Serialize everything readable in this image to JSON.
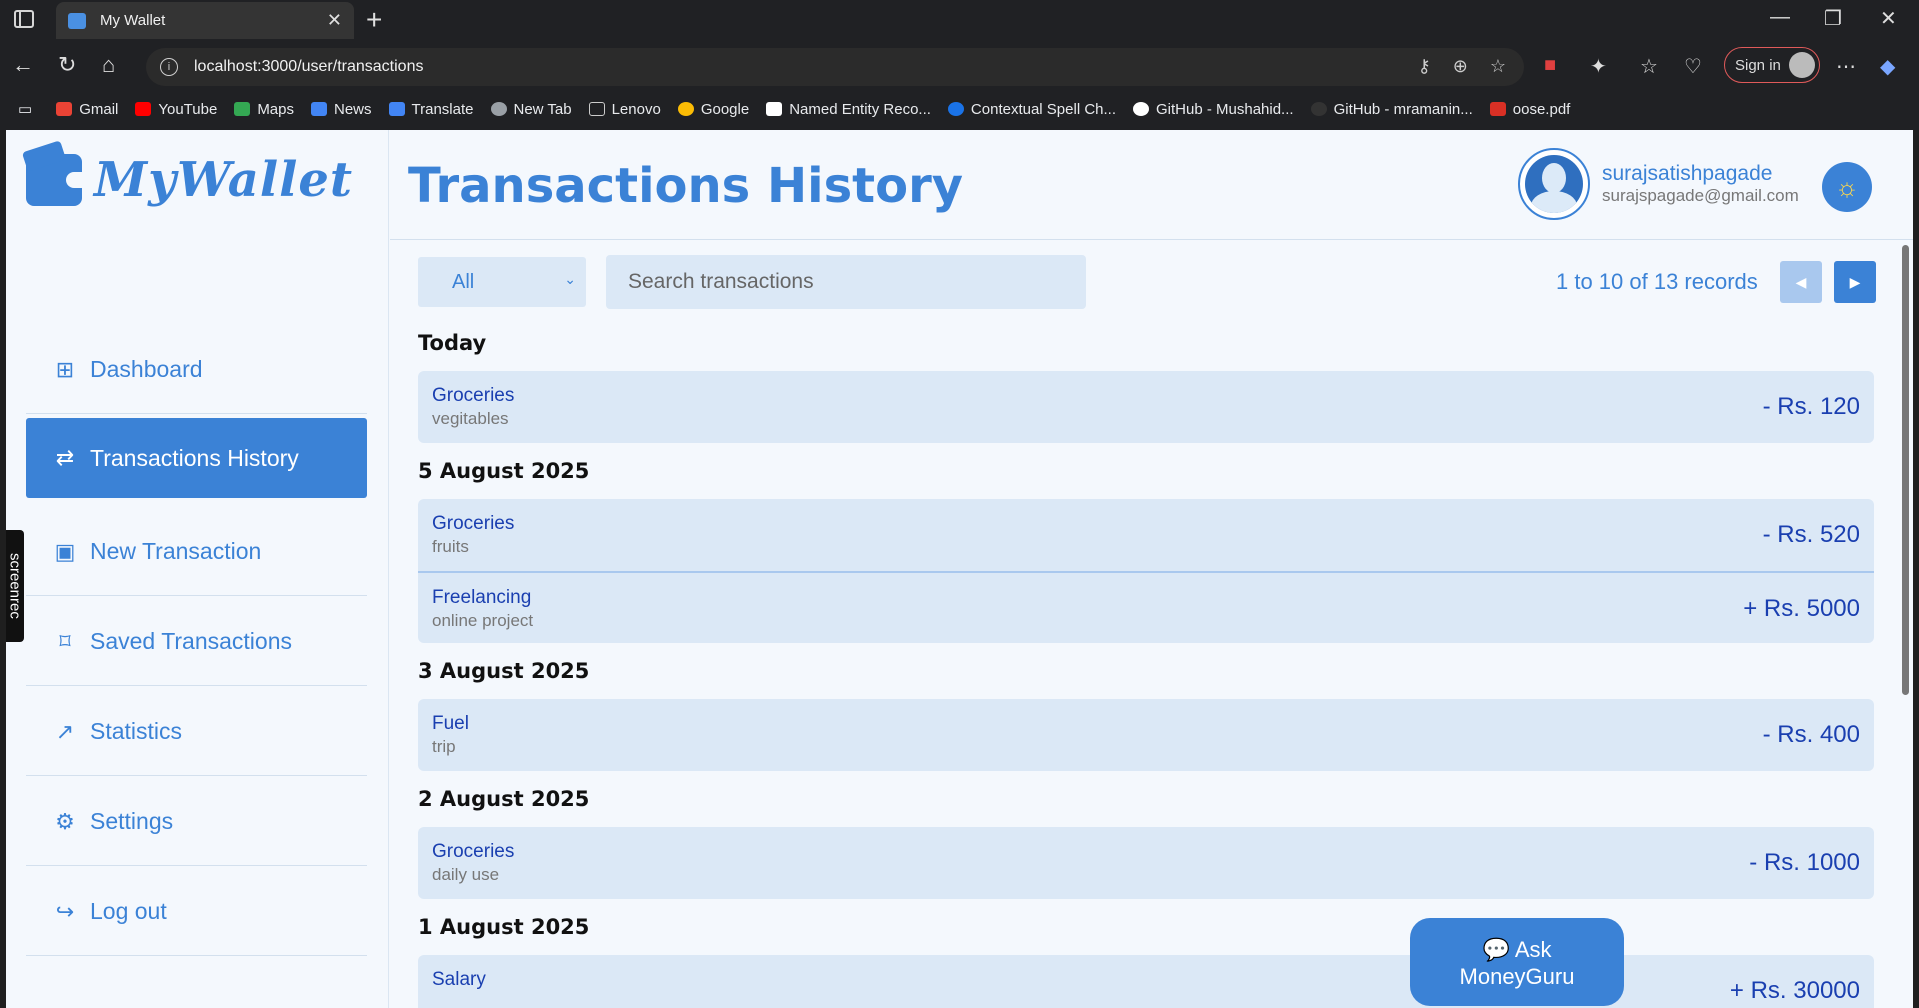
{
  "browser": {
    "tab_title": "My Wallet",
    "new_tab": "+",
    "url": "localhost:3000/user/transactions",
    "sign_in": "Sign in",
    "bookmarks": [
      {
        "label": "Gmail",
        "color": "#ea4335"
      },
      {
        "label": "YouTube",
        "color": "#ff0000"
      },
      {
        "label": "Maps",
        "color": "#34a853"
      },
      {
        "label": "News",
        "color": "#4285f4"
      },
      {
        "label": "Translate",
        "color": "#4285f4"
      },
      {
        "label": "New Tab",
        "color": "#9aa0a6"
      },
      {
        "label": "Lenovo",
        "color": "#9aa0a6"
      },
      {
        "label": "Google",
        "color": "#fbbc05"
      },
      {
        "label": "Named Entity Reco...",
        "color": "#ffffff"
      },
      {
        "label": "Contextual Spell Ch...",
        "color": "#1a73e8"
      },
      {
        "label": "GitHub - Mushahid...",
        "color": "#ffffff"
      },
      {
        "label": "GitHub - mramanin...",
        "color": "#333333"
      },
      {
        "label": "oose.pdf",
        "color": "#d93025"
      }
    ]
  },
  "sidebar": {
    "logo": "MyWallet",
    "items": [
      {
        "label": "Dashboard",
        "icon": "grid-icon",
        "active": false
      },
      {
        "label": "Transactions History",
        "icon": "arrows-exchange-icon",
        "active": true
      },
      {
        "label": "New Transaction",
        "icon": "calendar-plus-icon",
        "active": false
      },
      {
        "label": "Saved Transactions",
        "icon": "bookmark-icon",
        "active": false
      },
      {
        "label": "Statistics",
        "icon": "chart-line-icon",
        "active": false
      },
      {
        "label": "Settings",
        "icon": "gear-icon",
        "active": false
      },
      {
        "label": "Log out",
        "icon": "logout-icon",
        "active": false
      }
    ],
    "recorder_badge": "screenrec"
  },
  "header": {
    "title": "Transactions History",
    "username": "surajsatishpagade",
    "email": "surajspagade@gmail.com"
  },
  "toolbar": {
    "filter_value": "All",
    "search_placeholder": "Search transactions",
    "records_text": "1 to 10 of 13 records"
  },
  "groups": [
    {
      "date": "Today",
      "items": [
        {
          "category": "Groceries",
          "note": "vegitables",
          "amount": "- Rs. 120"
        }
      ]
    },
    {
      "date": "5 August 2025",
      "items": [
        {
          "category": "Groceries",
          "note": "fruits",
          "amount": "- Rs. 520"
        },
        {
          "category": "Freelancing",
          "note": "online project",
          "amount": "+ Rs. 5000"
        }
      ]
    },
    {
      "date": "3 August 2025",
      "items": [
        {
          "category": "Fuel",
          "note": "trip",
          "amount": "- Rs. 400"
        }
      ]
    },
    {
      "date": "2 August 2025",
      "items": [
        {
          "category": "Groceries",
          "note": "daily use",
          "amount": "- Rs. 1000"
        }
      ]
    },
    {
      "date": "1 August 2025",
      "items": [
        {
          "category": "Salary",
          "note": "",
          "amount": "+ Rs. 30000"
        }
      ]
    }
  ],
  "ask_button": {
    "line1": "Ask",
    "line2": "MoneyGuru"
  },
  "colors": {
    "accent": "#3b82d6",
    "row_bg": "#dbe8f6",
    "amount": "#1a3fb0"
  }
}
